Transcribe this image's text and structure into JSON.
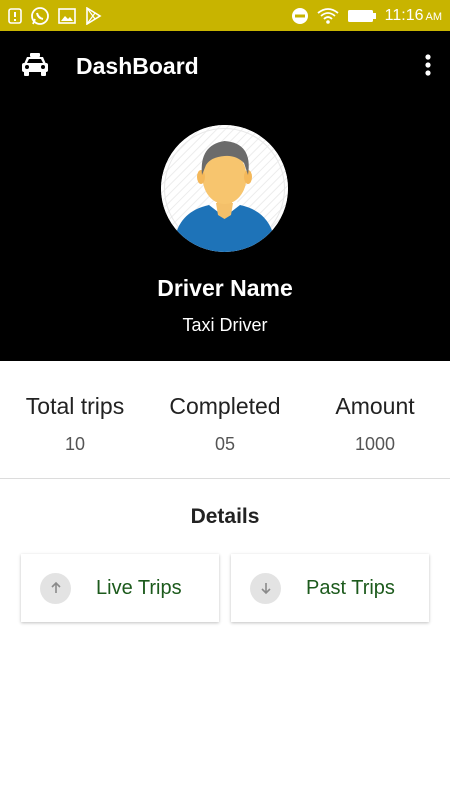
{
  "status_bar": {
    "time": "11:16",
    "ampm": "AM",
    "left_icons": [
      "notification-icon",
      "whatsapp-icon",
      "gallery-icon",
      "play-store-icon"
    ],
    "right_icons": [
      "do-not-disturb-icon",
      "wifi-icon",
      "battery-icon"
    ]
  },
  "toolbar": {
    "title": "DashBoard",
    "icon": "taxi-icon",
    "menu_icon": "more-vert-icon"
  },
  "profile": {
    "name": "Driver Name",
    "role": "Taxi Driver"
  },
  "stats": [
    {
      "label": "Total trips",
      "value": "10"
    },
    {
      "label": "Completed",
      "value": "05"
    },
    {
      "label": "Amount",
      "value": "1000"
    }
  ],
  "details": {
    "title": "Details",
    "buttons": [
      {
        "label": "Live Trips",
        "icon": "arrow-up-icon"
      },
      {
        "label": "Past Trips",
        "icon": "arrow-down-icon"
      }
    ]
  },
  "colors": {
    "status_bar": "#c8b400",
    "header": "#000000",
    "button_text": "#1c5a1c"
  }
}
